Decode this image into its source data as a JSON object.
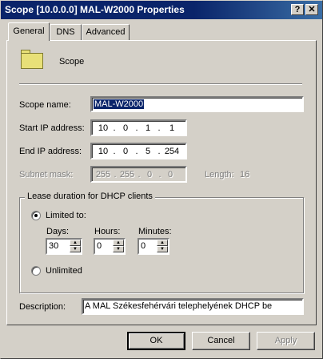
{
  "window": {
    "title": "Scope [10.0.0.0] MAL-W2000 Properties",
    "help_button": "?",
    "close_button": "✕"
  },
  "tabs": [
    {
      "label": "General",
      "active": true
    },
    {
      "label": "DNS",
      "active": false
    },
    {
      "label": "Advanced",
      "active": false
    }
  ],
  "header": {
    "icon": "folder-icon",
    "label": "Scope"
  },
  "form": {
    "scope_name": {
      "label": "Scope name:",
      "value": "MAL-W2000"
    },
    "start_ip": {
      "label": "Start IP address:",
      "octets": [
        "10",
        "0",
        "1",
        "1"
      ]
    },
    "end_ip": {
      "label": "End IP address:",
      "octets": [
        "10",
        "0",
        "5",
        "254"
      ]
    },
    "subnet_mask": {
      "label": "Subnet mask:",
      "octets": [
        "255",
        "255",
        "0",
        "0"
      ],
      "length_label": "Length:",
      "length_value": "16"
    }
  },
  "lease": {
    "group_title": "Lease duration for DHCP clients",
    "limited_label": "Limited to:",
    "limited_selected": true,
    "days_label": "Days:",
    "days_value": "30",
    "hours_label": "Hours:",
    "hours_value": "0",
    "minutes_label": "Minutes:",
    "minutes_value": "0",
    "unlimited_label": "Unlimited"
  },
  "description": {
    "label": "Description:",
    "value": "A MAL Székesfehérvári telephelyének DHCP be"
  },
  "buttons": {
    "ok": "OK",
    "cancel": "Cancel",
    "apply": "Apply"
  }
}
